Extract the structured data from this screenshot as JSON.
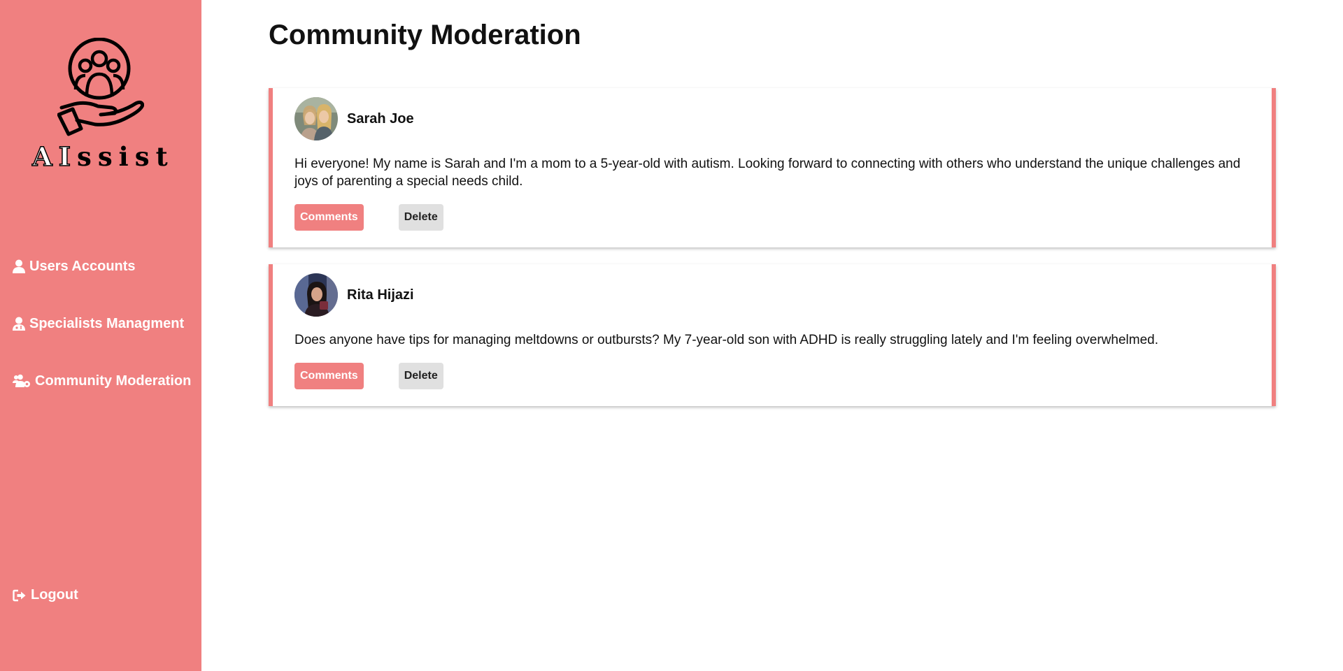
{
  "brand": {
    "name_prefix": "AI",
    "name_suffix": "ssist",
    "logo_icon": "community-hand-icon"
  },
  "sidebar": {
    "items": [
      {
        "label": "Users Accounts",
        "icon": "user-icon"
      },
      {
        "label": "Specialists Managment",
        "icon": "specialist-icon"
      },
      {
        "label": "Community Moderation",
        "icon": "users-cog-icon"
      }
    ],
    "logout": {
      "label": "Logout",
      "icon": "logout-icon"
    }
  },
  "main": {
    "title": "Community Moderation",
    "posts": [
      {
        "author": "Sarah Joe",
        "avatar": "avatar-photo",
        "body": "Hi everyone! My name is Sarah and I'm a mom to a 5-year-old with autism. Looking forward to connecting with others who understand the unique challenges and joys of parenting a special needs child.",
        "comments_label": "Comments",
        "delete_label": "Delete"
      },
      {
        "author": "Rita Hijazi",
        "avatar": "avatar-photo",
        "body": "Does anyone have tips for managing meltdowns or outbursts? My 7-year-old son with ADHD is really struggling lately and I'm feeling overwhelmed.",
        "comments_label": "Comments",
        "delete_label": "Delete"
      }
    ]
  },
  "colors": {
    "accent": "#f08080",
    "delete_button": "#e0e0e0",
    "text": "#111111",
    "sidebar_text": "#ffffff"
  }
}
